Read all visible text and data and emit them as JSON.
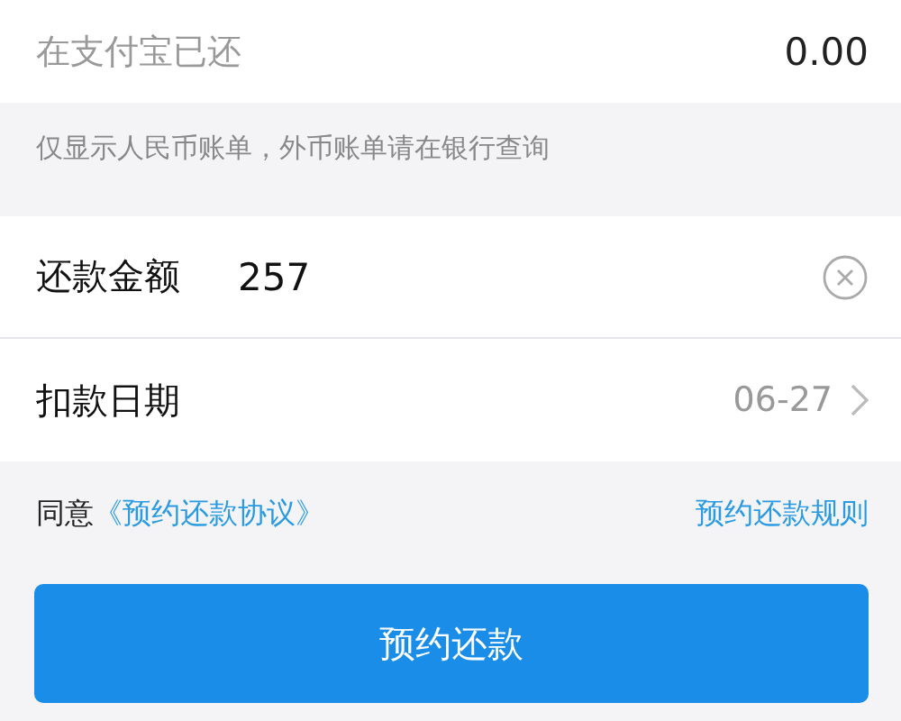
{
  "paid_row": {
    "label": "在支付宝已还",
    "value": "0.00"
  },
  "notice": "仅显示人民币账单，外币账单请在银行查询",
  "amount_row": {
    "label": "还款金额",
    "value": "257"
  },
  "date_row": {
    "label": "扣款日期",
    "value": "06-27"
  },
  "agreement": {
    "prefix": "同意",
    "link": "《预约还款协议》",
    "rules_link": "预约还款规则"
  },
  "submit_button": "预约还款"
}
